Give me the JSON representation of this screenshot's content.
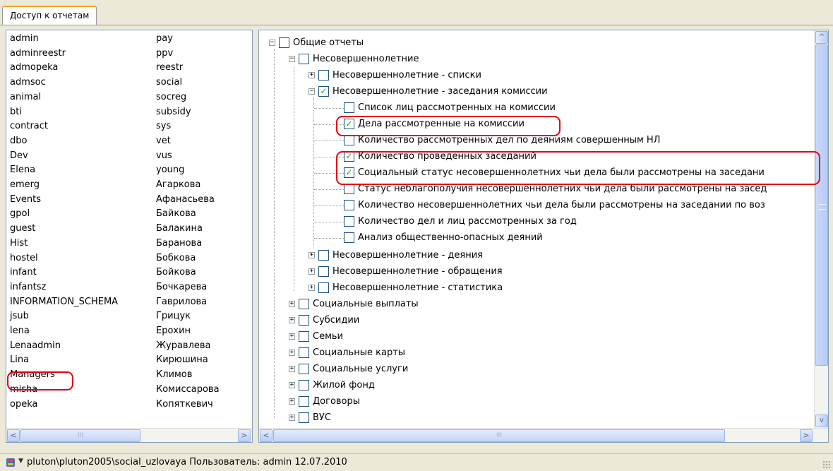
{
  "tab": {
    "label": "Доступ к отчетам"
  },
  "users_col1": [
    "admin",
    "adminreestr",
    "admopeka",
    "admsoc",
    "animal",
    "bti",
    "contract",
    "dbo",
    "Dev",
    "Elena",
    "emerg",
    "Events",
    "gpol",
    "guest",
    "Hist",
    "hostel",
    "infant",
    "infantsz",
    "INFORMATION_SCHEMA",
    "jsub",
    "lena",
    "Lenaadmin",
    "Lina",
    "Managers",
    "misha",
    "opeka"
  ],
  "users_col2": [
    "pay",
    "ppv",
    "reestr",
    "social",
    "socreg",
    "subsidy",
    "sys",
    "vet",
    "vus",
    "young",
    "Агаркова",
    "Афанасьева",
    "Байкова",
    "Балакина",
    "Баранова",
    "Бобкова",
    "Бойкова",
    "Бочкарева",
    "Гаврилова",
    "Грицук",
    "Ерохин",
    "Журавлева",
    "Кирюшина",
    "Климов",
    "Комиссарова",
    "Копяткевич"
  ],
  "tree": {
    "root": "Общие отчеты",
    "minors": "Несовершеннолетние",
    "minors_lists": "Несовершеннолетние - списки",
    "minors_sessions": "Несовершеннолетние - заседания комиссии",
    "r1": "Список лиц рассмотренных на комиссии",
    "r2": "Дела рассмотренные на комиссии",
    "r3": "Количество рассмотренных дел по деяниям совершенным НЛ",
    "r4": "Количество проведённых заседаний",
    "r5": "Социальный статус несовершеннолетних чьи дела были рассмотрены на заседани",
    "r6": "Статус неблагополучия несовершеннолетних чьи дела были рассмотрены на засед",
    "r7": "Количество несовершеннолетних чьи дела были рассмотрены на заседании по воз",
    "r8": "Количество дел и лиц рассмотренных за год",
    "r9": "Анализ общественно-опасных деяний",
    "minors_acts": "Несовершеннолетние - деяния",
    "minors_appeals": "Несовершеннолетние - обращения",
    "minors_stats": "Несовершеннолетние - статистика",
    "social_payments": "Социальные выплаты",
    "subsidies": "Субсидии",
    "families": "Семьи",
    "social_cards": "Социальные карты",
    "social_services": "Социальные услуги",
    "housing": "Жилой фонд",
    "contracts": "Договоры",
    "cut_off": "ВУС",
    "checked_glyph": "✓",
    "plus": "+",
    "minus": "−"
  },
  "status": {
    "text": "pluton\\pluton2005\\social_uzlovaya   Пользователь: admin  12.07.2010",
    "arrow": "▼"
  },
  "scroll": {
    "left": "<",
    "right": ">",
    "up": "^",
    "down": "v",
    "grip": "III"
  },
  "colors": {
    "highlight": "#e3000f",
    "check": "#21a121",
    "tab_accent": "#f5a623"
  }
}
